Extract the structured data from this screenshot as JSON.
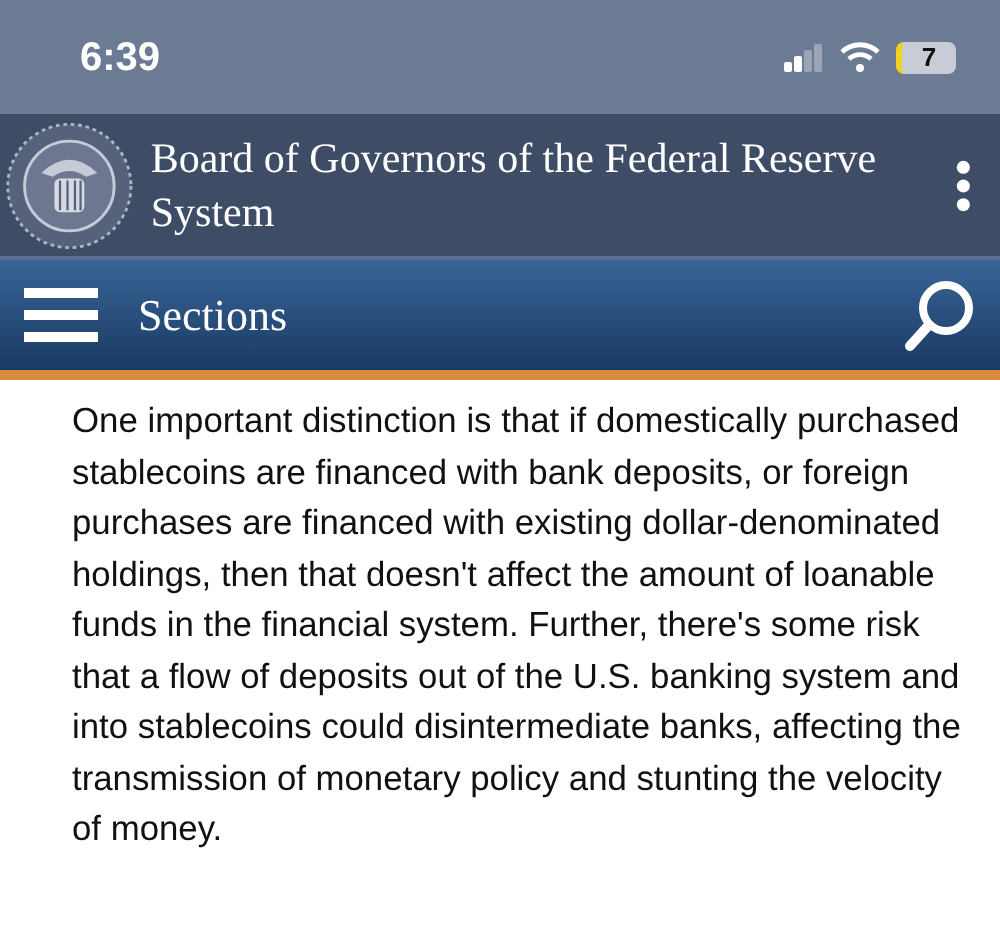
{
  "status_bar": {
    "time": "6:39",
    "battery": "7"
  },
  "header": {
    "title": "Board of Governors of the Federal Reserve System"
  },
  "sections_bar": {
    "label": "Sections"
  },
  "article": {
    "paragraph": "One important distinction is that if domestically purchased stablecoins are financed with bank deposits, or foreign purchases are financed with existing dollar-denominated holdings, then that doesn't affect the amount of loanable funds in the financial system. Further, there's some risk that a flow of deposits out of the U.S. banking system and into stablecoins could disintermediate banks, affecting the transmission of monetary policy and stunting the velocity of money."
  }
}
